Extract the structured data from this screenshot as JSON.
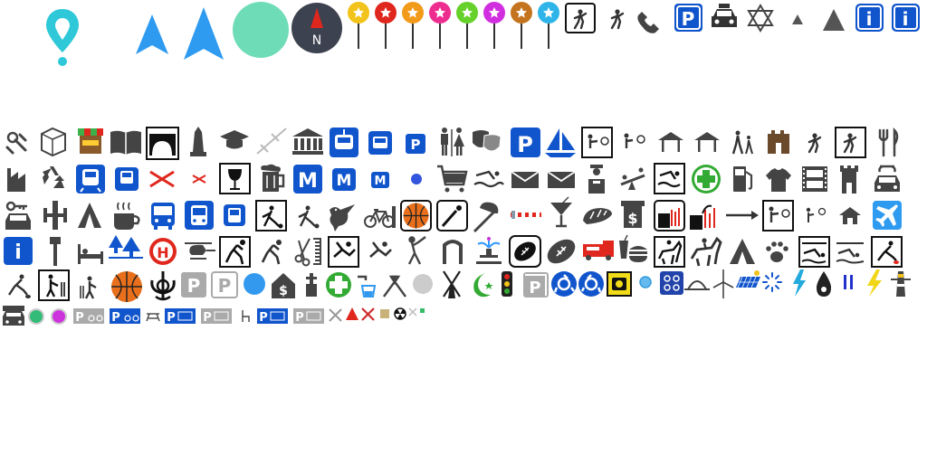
{
  "sheet": {
    "title": "",
    "labels": {
      "north": "N",
      "parking": "P",
      "metro": "M",
      "hospital": "H",
      "info": "i",
      "money": "$"
    }
  },
  "colors": {
    "teal": "#2fc8d8",
    "mint": "#6fdcb8",
    "nav_blue": "#2e9af0",
    "compass_bg": "#3d4250",
    "compass_needle": "#e0271d",
    "brand_blue": "#1155cc",
    "icon_dark": "#333333",
    "orange": "#e86f1b",
    "green_plus": "#33aa33",
    "grey_sign": "#aaaaaa"
  },
  "rows": {
    "top": [
      "location-pin",
      "navigation-arrow-small",
      "navigation-arrow-large",
      "mint-circle",
      "compass-north",
      "star-pin-yellow",
      "star-pin-red",
      "star-pin-orange",
      "star-pin-pink",
      "star-pin-green",
      "star-pin-magenta",
      "star-pin-brown",
      "star-pin-lightblue",
      "tennis-sign",
      "tennis-player",
      "telephone",
      "parking-square",
      "taxi",
      "star-of-david",
      "small-triangle",
      "large-triangle",
      "info-square",
      "info-square-alt"
    ],
    "row1": [
      "baby-pacifier",
      "alphabet-block",
      "market-stall",
      "open-book",
      "bridge-arch",
      "obelisk",
      "graduation-cap",
      "level-crossing",
      "museum",
      "tram-sign",
      "tram-small",
      "parking-small",
      "toilets",
      "theatre-masks",
      "parking-large",
      "sailing",
      "shooting-range",
      "archery",
      "shelter",
      "shelter-alt",
      "family-walk",
      "castle-ruin",
      "soccer",
      "soccer-sign",
      "cutlery"
    ],
    "row2": [
      "factory",
      "recycling",
      "train-sign",
      "train-small",
      "crossing-x",
      "crossing-x-small",
      "wine-glass",
      "beer",
      "metro-large",
      "metro-medium",
      "metro-small",
      "blue-dot",
      "shopping-cart",
      "swimming",
      "mail",
      "mail-alt",
      "police-officer",
      "playground",
      "swimming-sign",
      "first-aid",
      "fuel-pump",
      "clothes",
      "cinema",
      "tower",
      "car-repair"
    ],
    "row3": [
      "car-key",
      "gym",
      "camping",
      "cafe",
      "bus",
      "bus-sign",
      "bus-small",
      "bowls-sign",
      "bowls",
      "bird",
      "bicycle",
      "basketball-sign",
      "baseball-sign",
      "baseball",
      "barrier",
      "cocktail",
      "bakery",
      "atm",
      "waterfall-sign",
      "waterfall",
      "arrow-right",
      "archery-sign",
      "archery-small",
      "house",
      "airport"
    ],
    "row4": [
      "info-sign",
      "kiosk",
      "hostel",
      "wooded",
      "helipad-sign",
      "helicopter",
      "handball-sign",
      "handball",
      "hairdresser",
      "gymnastics-sign",
      "gymnastics",
      "golf",
      "gate",
      "fountain",
      "football-sign",
      "football",
      "fire-engine",
      "fast-food",
      "equestrian-sign",
      "equestrian",
      "campsite",
      "dog-paw",
      "diving-sign",
      "diving",
      "curling-sign"
    ],
    "row5": [
      "curling",
      "cricket-sign",
      "cricket",
      "basketball-orange",
      "khanda",
      "parking-grey",
      "parking-outline",
      "blue-circle",
      "bank",
      "chemist",
      "medical-plus",
      "drinking-water",
      "cross-flags",
      "grey-circle",
      "windmill",
      "crescent",
      "traffic-light",
      "parking-corner",
      "roundabout",
      "roundabout-alt",
      "speed-camera",
      "blue-dot-small",
      "sewing-box",
      "dome",
      "wind-turbine",
      "solar-panel",
      "sparkle",
      "lightning-cyan",
      "water-drop",
      "pause-bars",
      "lightning-yellow",
      "lighthouse"
    ],
    "row6": [
      "car-train",
      "green-dot",
      "magenta-dot",
      "parking-bike",
      "parking-bike-blue",
      "picnic",
      "parking-blue",
      "parking-grey-small",
      "chair",
      "parking-blue-2",
      "parking-grey-2",
      "cross-grey",
      "triangle-red",
      "cross-red",
      "square-tan",
      "radiation",
      "cross-small",
      "square-green"
    ]
  }
}
